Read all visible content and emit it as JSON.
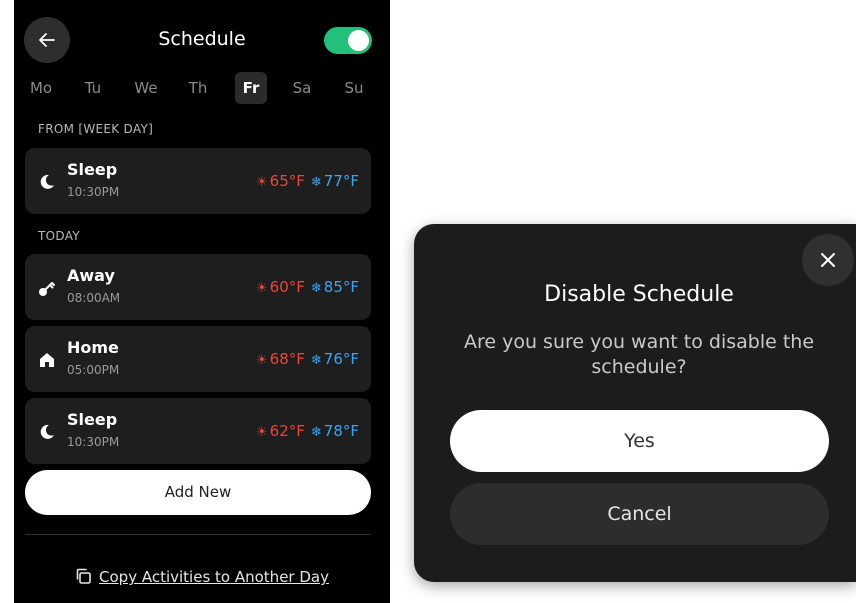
{
  "schedule": {
    "title": "Schedule",
    "enabled": true,
    "toggle_color": "#22c07a",
    "days": [
      "Mo",
      "Tu",
      "We",
      "Th",
      "Fr",
      "Sa",
      "Su"
    ],
    "selected_day": "Fr",
    "section_from": "FROM [WEEK DAY]",
    "section_today": "TODAY",
    "from_items": [
      {
        "name": "Sleep",
        "time": "10:30PM",
        "icon": "moon-icon",
        "heat": "65°F",
        "cool": "77°F"
      }
    ],
    "today_items": [
      {
        "name": "Away",
        "time": "08:00AM",
        "icon": "key-icon",
        "heat": "60°F",
        "cool": "85°F"
      },
      {
        "name": "Home",
        "time": "05:00PM",
        "icon": "home-icon",
        "heat": "68°F",
        "cool": "76°F"
      },
      {
        "name": "Sleep",
        "time": "10:30PM",
        "icon": "moon-icon",
        "heat": "62°F",
        "cool": "78°F"
      }
    ],
    "heat_color": "#f0453a",
    "cool_color": "#3aa6f0",
    "add_new_label": "Add New",
    "copy_label": "Copy Activities to Another Day"
  },
  "dialog": {
    "title": "Disable Schedule",
    "message": "Are you sure you want to disable the schedule?",
    "yes_label": "Yes",
    "cancel_label": "Cancel"
  }
}
